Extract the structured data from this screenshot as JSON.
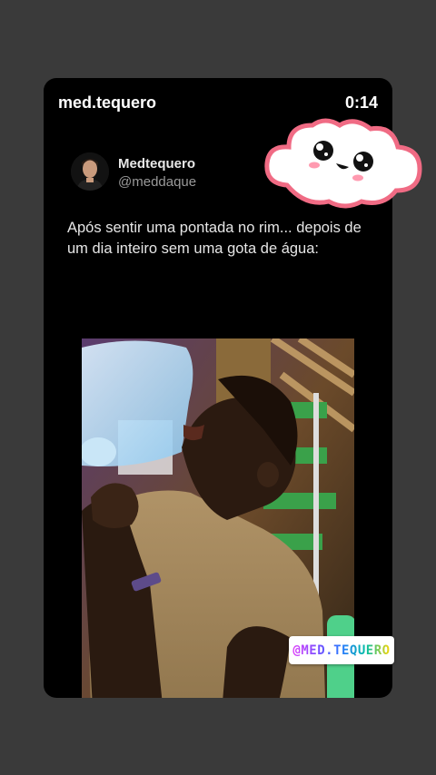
{
  "story": {
    "account_name": "med.tequero",
    "time": "0:14"
  },
  "post": {
    "author_name": "Medtequero",
    "author_handle": "@meddaque",
    "text": "Após sentir uma pontada no rim... depois de um dia inteiro sem uma gota de água:"
  },
  "sticker": {
    "icon": "kawaii-cloud-sticker"
  },
  "watermark": {
    "text": "@MED.TEQUERO"
  },
  "colors": {
    "background": "#3a3a3a",
    "card": "#000000",
    "cloud_outline": "#f06b84"
  }
}
